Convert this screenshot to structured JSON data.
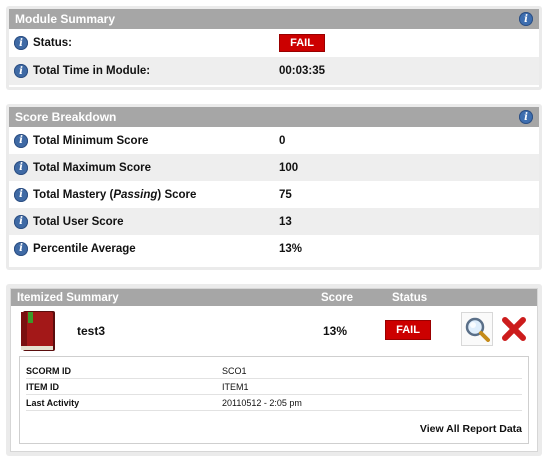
{
  "module_summary": {
    "title": "Module Summary",
    "rows": [
      {
        "label": "Status:",
        "value": "FAIL"
      },
      {
        "label": "Total Time in Module:",
        "value": "00:03:35"
      }
    ]
  },
  "score_breakdown": {
    "title": "Score Breakdown",
    "rows": [
      {
        "label": "Total Minimum Score",
        "value": "0"
      },
      {
        "label": "Total Maximum Score",
        "value": "100"
      },
      {
        "label_pre": "Total Mastery (",
        "label_em": "Passing",
        "label_post": ") Score",
        "value": "75"
      },
      {
        "label": "Total User Score",
        "value": "13"
      },
      {
        "label": "Percentile Average",
        "value": "13%"
      }
    ]
  },
  "itemized_summary": {
    "header": {
      "title": "Itemized Summary",
      "score": "Score",
      "status": "Status"
    },
    "item": {
      "name": "test3",
      "score": "13%",
      "status": "FAIL"
    },
    "details": [
      {
        "key": "SCORM ID",
        "value": "SCO1"
      },
      {
        "key": "ITEM ID",
        "value": "ITEM1"
      },
      {
        "key": "Last Activity",
        "value": "20110512 - 2:05 pm"
      }
    ],
    "view_all_label": "View All Report Data"
  },
  "colors": {
    "header": "#a6a6a6",
    "fail": "#cc0000",
    "info": "#3f6aa5"
  },
  "icons": [
    "info-icon",
    "book-icon",
    "magnifier-icon",
    "delete-x-icon"
  ]
}
